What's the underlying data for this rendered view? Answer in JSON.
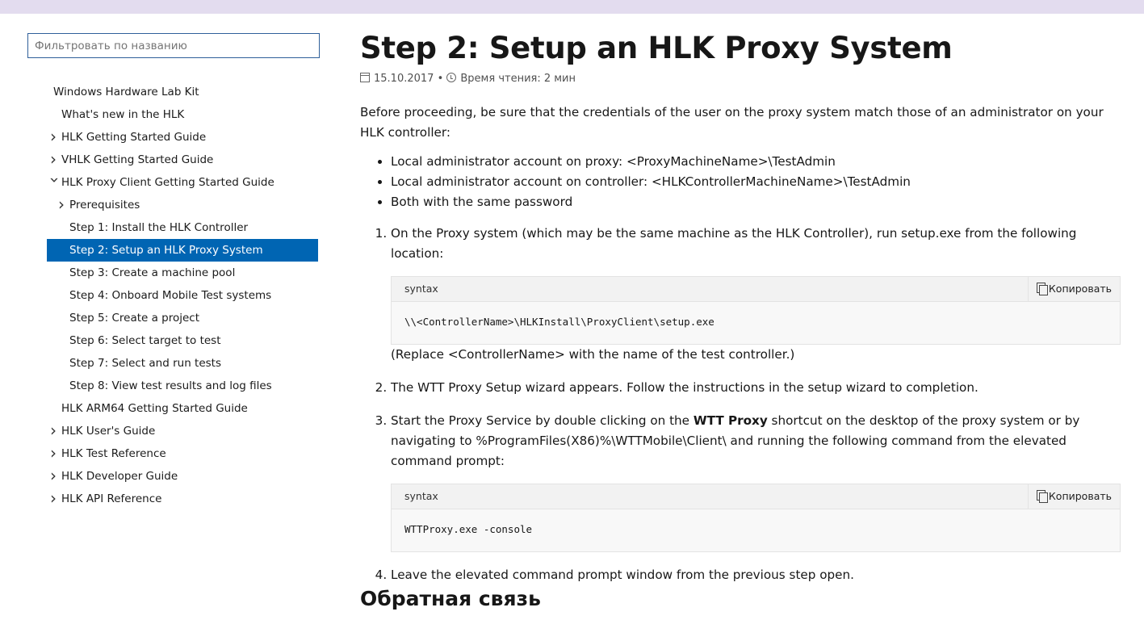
{
  "sidebar": {
    "filter_placeholder": "Фильтровать по названию",
    "items": [
      {
        "label": "Windows Hardware Lab Kit",
        "level": 0,
        "chevron": "none",
        "active": false
      },
      {
        "label": "What's new in the HLK",
        "level": 1,
        "chevron": "none",
        "active": false
      },
      {
        "label": "HLK Getting Started Guide",
        "level": 1,
        "chevron": "closed",
        "active": false
      },
      {
        "label": "VHLK Getting Started Guide",
        "level": 1,
        "chevron": "closed",
        "active": false
      },
      {
        "label": "HLK Proxy Client Getting Started Guide",
        "level": 1,
        "chevron": "open",
        "active": false
      },
      {
        "label": "Prerequisites",
        "level": 2,
        "chevron": "closed",
        "active": false
      },
      {
        "label": "Step 1: Install the HLK Controller",
        "level": 2,
        "chevron": "none",
        "active": false
      },
      {
        "label": "Step 2: Setup an HLK Proxy System",
        "level": 2,
        "chevron": "none",
        "active": true
      },
      {
        "label": "Step 3: Create a machine pool",
        "level": 2,
        "chevron": "none",
        "active": false
      },
      {
        "label": "Step 4: Onboard Mobile Test systems",
        "level": 2,
        "chevron": "none",
        "active": false
      },
      {
        "label": "Step 5: Create a project",
        "level": 2,
        "chevron": "none",
        "active": false
      },
      {
        "label": "Step 6: Select target to test",
        "level": 2,
        "chevron": "none",
        "active": false
      },
      {
        "label": "Step 7: Select and run tests",
        "level": 2,
        "chevron": "none",
        "active": false
      },
      {
        "label": "Step 8: View test results and log files",
        "level": 2,
        "chevron": "none",
        "active": false
      },
      {
        "label": "HLK ARM64 Getting Started Guide",
        "level": 1,
        "chevron": "none",
        "active": false
      },
      {
        "label": "HLK User's Guide",
        "level": 1,
        "chevron": "closed",
        "active": false
      },
      {
        "label": "HLK Test Reference",
        "level": 1,
        "chevron": "closed",
        "active": false
      },
      {
        "label": "HLK Developer Guide",
        "level": 1,
        "chevron": "closed",
        "active": false
      },
      {
        "label": "HLK API Reference",
        "level": 1,
        "chevron": "closed",
        "active": false
      }
    ]
  },
  "article": {
    "title": "Step 2: Setup an HLK Proxy System",
    "date": "15.10.2017",
    "separator": "•",
    "reading_time": "Время чтения: 2 мин",
    "intro": "Before proceeding, be sure that the credentials of the user on the proxy system match those of an administrator on your HLK controller:",
    "bullets": [
      "Local administrator account on proxy: <ProxyMachineName>\\TestAdmin",
      "Local administrator account on controller: <HLKControllerMachineName>\\TestAdmin",
      "Both with the same password"
    ],
    "step1": {
      "text": "On the Proxy system (which may be the same machine as the HLK Controller), run setup.exe from the following location:",
      "code_lang": "syntax",
      "copy_label": "Копировать",
      "code": "\\\\<ControllerName>\\HLKInstall\\ProxyClient\\setup.exe",
      "note": "(Replace <ControllerName> with the name of the test controller.)"
    },
    "step2": {
      "text": "The WTT Proxy Setup wizard appears. Follow the instructions in the setup wizard to completion."
    },
    "step3": {
      "text_before": "Start the Proxy Service by double clicking on the ",
      "bold": "WTT Proxy",
      "text_after": " shortcut on the desktop of the proxy system or by navigating to %ProgramFiles(X86)%\\WTTMobile\\Client\\ and running the following command from the elevated command prompt:",
      "code_lang": "syntax",
      "copy_label": "Копировать",
      "code": "WTTProxy.exe -console"
    },
    "step4": {
      "text": "Leave the elevated command prompt window from the previous step open."
    },
    "feedback_heading": "Обратная связь"
  },
  "colors": {
    "top_bar": "#e3dcef",
    "active_item_bg": "#0065b3",
    "filter_border": "#2f5f9a"
  }
}
